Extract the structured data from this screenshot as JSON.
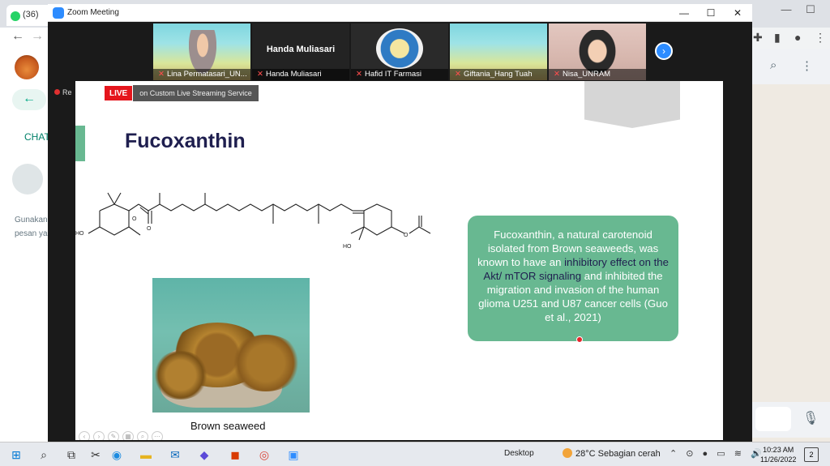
{
  "background_browser": {
    "tab_label": "(36)",
    "nav_back": "←",
    "nav_forward": "→",
    "wa_chat_label": "CHAT",
    "wa_hint_line1": "Gunakan",
    "wa_hint_line2": "pesan ya",
    "window_min": "—",
    "window_max": "☐",
    "window_close": "✕"
  },
  "zoom": {
    "title": "Zoom Meeting",
    "recording_label": "Re",
    "live_tag": "LIVE",
    "live_service": "on Custom Live Streaming Service",
    "next_arrow": "›",
    "participants": [
      {
        "name": "Lina Permatasari_UN..."
      },
      {
        "name": "Handa Muliasari",
        "display_name": "Handa Muliasari"
      },
      {
        "name": "Hafid IT Farmasi"
      },
      {
        "name": "Giftania_Hang Tuah"
      },
      {
        "name": "Nisa_UNRAM"
      }
    ]
  },
  "slide": {
    "title": "Fucoxanthin",
    "caption": "Brown seaweed",
    "info_part1": "Fucoxanthin, a natural carotenoid isolated from Brown seaweeds, was known to have an ",
    "info_highlight": "inhibitory effect on the Akt/ mTOR signaling",
    "info_part2": " and inhibited the migration and invasion of the human glioma U251 and U87 cancer cells (Guo et al., 2021)",
    "molecule_labels": {
      "ho_left": "HO",
      "o_epoxy": "O",
      "o_keto": "O",
      "ho_right": "HO",
      "o_ester": "O"
    }
  },
  "taskbar": {
    "desktop_label": "Desktop",
    "temperature": "28°C",
    "weather": "Sebagian cerah",
    "time": "10:23 AM",
    "date": "11/26/2022",
    "notifications": "2"
  }
}
